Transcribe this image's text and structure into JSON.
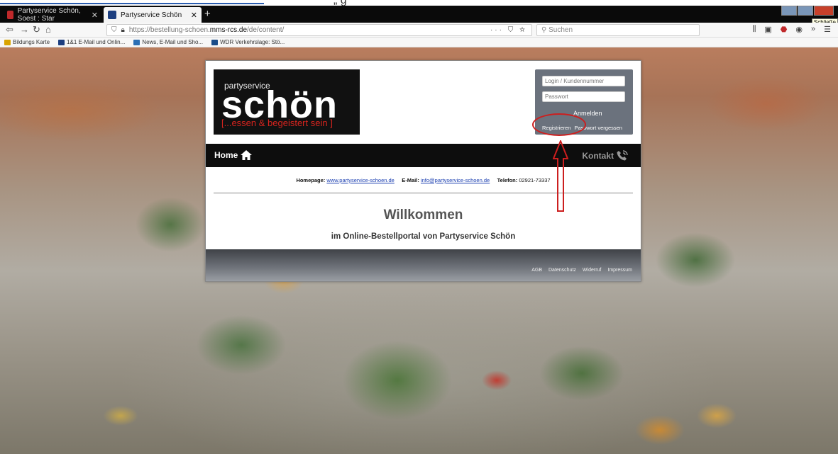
{
  "browser": {
    "tabs": [
      {
        "label": "Partyservice Schön, Soest : Star",
        "active": false
      },
      {
        "label": "Partyservice Schön",
        "active": true
      }
    ],
    "new_tab": "+",
    "tooltip": "Schließe",
    "url_prefix": "https://bestellung-schoen.",
    "url_strong": "mms-rcs.de",
    "url_suffix": "/de/content/",
    "url_actions": "··· ⛉ ☆",
    "search_placeholder": "Suchen",
    "bookmarks": [
      {
        "label": "Bildungs Karte",
        "color": "#d9a400"
      },
      {
        "label": "1&1 E-Mail und Onlin...",
        "color": "#1d3f80"
      },
      {
        "label": "News, E-Mail und Sho...",
        "color": "#2b6fb5"
      },
      {
        "label": "WDR Verkehrslage: Stö...",
        "color": "#1a4d8a"
      }
    ]
  },
  "doc_strip": {
    "text": "„                                              g"
  },
  "site": {
    "logo": {
      "pre": "partyservice",
      "big": "schön",
      "tagline": "[...essen & begeistert sein ]"
    },
    "login": {
      "user_placeholder": "Login / Kundennummer",
      "password_placeholder": "Passwort",
      "submit": "Anmelden",
      "register": "Registrieren",
      "forgot": "Passwort vergessen"
    },
    "menu": {
      "home": "Home",
      "contact": "Kontakt"
    },
    "info": {
      "homepage_label": "Homepage:",
      "homepage_url": "www.partyservice-schoen.de",
      "email_label": "E-Mail:",
      "email": "info@partyservice-schoen.de",
      "phone_label": "Telefon:",
      "phone": "02921-73337"
    },
    "welcome": "Willkommen",
    "subwelcome": "im Online-Bestellportal von Partyservice Schön",
    "footer_links": [
      "AGB",
      "Datenschutz",
      "Widerruf",
      "Impressum"
    ]
  },
  "colors": {
    "accent_red": "#d6241e",
    "annotation_red": "#cc1f1f",
    "login_box": "#6b727d"
  }
}
